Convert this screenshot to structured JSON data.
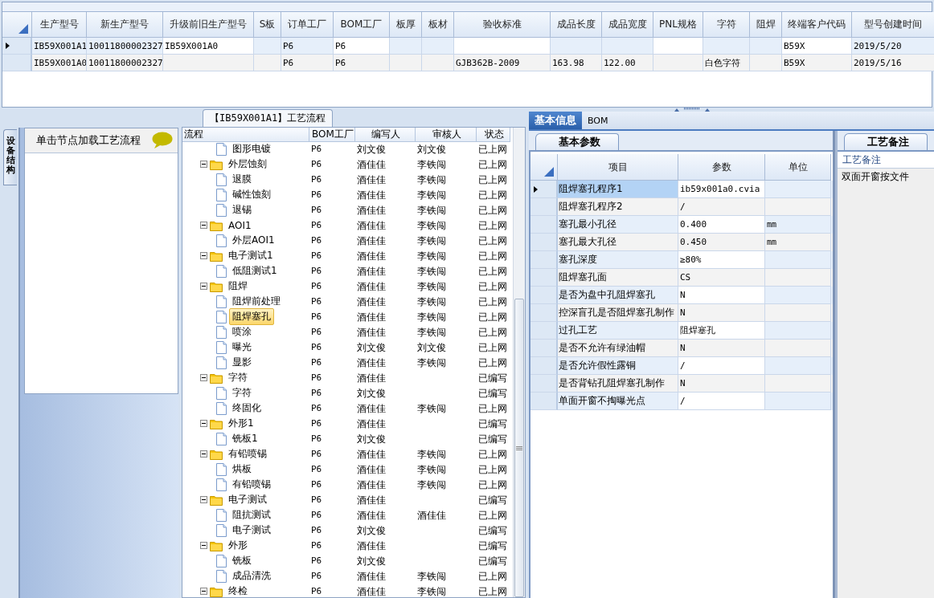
{
  "model_grid": {
    "columns": [
      "生产型号",
      "新生产型号",
      "升级前旧生产型号",
      "S板",
      "订单工厂",
      "BOM工厂",
      "板厚",
      "板材",
      "验收标准",
      "成品长度",
      "成品宽度",
      "PNL规格",
      "字符",
      "阻焊",
      "终端客户代码",
      "型号创建时间"
    ],
    "rows": [
      {
        "selected": true,
        "cells": [
          "IB59X001A1",
          "10011800002327",
          "IB59X001A0",
          "",
          "P6",
          "P6",
          "",
          "",
          "",
          "",
          "",
          "",
          "",
          "",
          "B59X",
          "2019/5/20"
        ]
      },
      {
        "selected": false,
        "cells": [
          "IB59X001A0",
          "10011800002327",
          "",
          "",
          "P6",
          "P6",
          "",
          "",
          "GJB362B-2009",
          "163.98",
          "122.00",
          "",
          "白色字符",
          "",
          "B59X",
          "2019/5/16"
        ]
      }
    ]
  },
  "left_panel": {
    "side_tab": "设备结构",
    "hint": "单击节点加载工艺流程"
  },
  "flow": {
    "title": "【IB59X001A1】工艺流程",
    "columns": [
      "流程",
      "BOM工厂",
      "编写人",
      "审核人",
      "状态"
    ],
    "partial_children": [
      {
        "name": "图形电镀",
        "bom": "P6",
        "author": "刘文俊",
        "reviewer": "刘文俊",
        "status": "已上网",
        "selected": false
      }
    ],
    "nodes": [
      {
        "name": "外层蚀刻",
        "bom": "P6",
        "author": "酒佳佳",
        "reviewer": "李铁闯",
        "status": "已上网",
        "selected": false,
        "expanded": true,
        "children": [
          {
            "name": "退膜",
            "bom": "P6",
            "author": "酒佳佳",
            "reviewer": "李铁闯",
            "status": "已上网",
            "selected": false
          },
          {
            "name": "碱性蚀刻",
            "bom": "P6",
            "author": "酒佳佳",
            "reviewer": "李铁闯",
            "status": "已上网",
            "selected": false
          },
          {
            "name": "退锡",
            "bom": "P6",
            "author": "酒佳佳",
            "reviewer": "李铁闯",
            "status": "已上网",
            "selected": false
          }
        ]
      },
      {
        "name": "AOI1",
        "bom": "P6",
        "author": "酒佳佳",
        "reviewer": "李铁闯",
        "status": "已上网",
        "selected": false,
        "expanded": true,
        "children": [
          {
            "name": "外层AOI1",
            "bom": "P6",
            "author": "酒佳佳",
            "reviewer": "李铁闯",
            "status": "已上网",
            "selected": false
          }
        ]
      },
      {
        "name": "电子测试1",
        "bom": "P6",
        "author": "酒佳佳",
        "reviewer": "李铁闯",
        "status": "已上网",
        "selected": false,
        "expanded": true,
        "children": [
          {
            "name": "低阻测试1",
            "bom": "P6",
            "author": "酒佳佳",
            "reviewer": "李铁闯",
            "status": "已上网",
            "selected": false
          }
        ]
      },
      {
        "name": "阻焊",
        "bom": "P6",
        "author": "酒佳佳",
        "reviewer": "李铁闯",
        "status": "已上网",
        "selected": false,
        "expanded": true,
        "children": [
          {
            "name": "阻焊前处理",
            "bom": "P6",
            "author": "酒佳佳",
            "reviewer": "李铁闯",
            "status": "已上网",
            "selected": false
          },
          {
            "name": "阻焊塞孔",
            "bom": "P6",
            "author": "酒佳佳",
            "reviewer": "李铁闯",
            "status": "已上网",
            "selected": true
          },
          {
            "name": "喷涂",
            "bom": "P6",
            "author": "酒佳佳",
            "reviewer": "李铁闯",
            "status": "已上网",
            "selected": false
          },
          {
            "name": "曝光",
            "bom": "P6",
            "author": "刘文俊",
            "reviewer": "刘文俊",
            "status": "已上网",
            "selected": false
          },
          {
            "name": "显影",
            "bom": "P6",
            "author": "酒佳佳",
            "reviewer": "李铁闯",
            "status": "已上网",
            "selected": false
          }
        ]
      },
      {
        "name": "字符",
        "bom": "P6",
        "author": "酒佳佳",
        "status": "已编写",
        "selected": false,
        "expanded": true,
        "children": [
          {
            "name": "字符",
            "bom": "P6",
            "author": "刘文俊",
            "status": "已编写",
            "selected": false
          },
          {
            "name": "终固化",
            "bom": "P6",
            "author": "酒佳佳",
            "reviewer": "李铁闯",
            "status": "已上网",
            "selected": false
          }
        ]
      },
      {
        "name": "外形1",
        "bom": "P6",
        "author": "酒佳佳",
        "status": "已编写",
        "selected": false,
        "expanded": true,
        "children": [
          {
            "name": "铣板1",
            "bom": "P6",
            "author": "刘文俊",
            "status": "已编写",
            "selected": false
          }
        ]
      },
      {
        "name": "有铅喷锡",
        "bom": "P6",
        "author": "酒佳佳",
        "reviewer": "李铁闯",
        "status": "已上网",
        "selected": false,
        "expanded": true,
        "children": [
          {
            "name": "烘板",
            "bom": "P6",
            "author": "酒佳佳",
            "reviewer": "李铁闯",
            "status": "已上网",
            "selected": false
          },
          {
            "name": "有铅喷锡",
            "bom": "P6",
            "author": "酒佳佳",
            "reviewer": "李铁闯",
            "status": "已上网",
            "selected": false
          }
        ]
      },
      {
        "name": "电子测试",
        "bom": "P6",
        "author": "酒佳佳",
        "status": "已编写",
        "selected": false,
        "expanded": true,
        "children": [
          {
            "name": "阻抗测试",
            "bom": "P6",
            "author": "酒佳佳",
            "reviewer": "酒佳佳",
            "status": "已上网",
            "selected": false
          },
          {
            "name": "电子测试",
            "bom": "P6",
            "author": "刘文俊",
            "status": "已编写",
            "selected": false
          }
        ]
      },
      {
        "name": "外形",
        "bom": "P6",
        "author": "酒佳佳",
        "status": "已编写",
        "selected": false,
        "expanded": true,
        "children": [
          {
            "name": "铣板",
            "bom": "P6",
            "author": "刘文俊",
            "status": "已编写",
            "selected": false
          },
          {
            "name": "成品清洗",
            "bom": "P6",
            "author": "酒佳佳",
            "reviewer": "李铁闯",
            "status": "已上网",
            "selected": false
          }
        ]
      },
      {
        "name": "终检",
        "bom": "P6",
        "author": "酒佳佳",
        "reviewer": "李铁闯",
        "status": "已上网",
        "selected": false,
        "expanded": true
      }
    ]
  },
  "detail_tabs": [
    {
      "label": "基本信息",
      "selected": true
    },
    {
      "label": "BOM",
      "selected": false
    }
  ],
  "params": {
    "tab": "基本参数",
    "columns": [
      "项目",
      "参数",
      "单位"
    ],
    "rows": [
      {
        "item": "阻焊塞孔程序1",
        "value": "ib59x001a0.cvia",
        "selected": true
      },
      {
        "item": "阻焊塞孔程序2",
        "value": "/",
        "selected": false
      },
      {
        "item": "塞孔最小孔径",
        "value": "0.400",
        "unit": "mm",
        "selected": false
      },
      {
        "item": "塞孔最大孔径",
        "value": "0.450",
        "unit": "mm",
        "selected": false
      },
      {
        "item": "塞孔深度",
        "value": "≥80%",
        "selected": false
      },
      {
        "item": "阻焊塞孔面",
        "value": "CS",
        "selected": false
      },
      {
        "item": "是否为盘中孔阻焊塞孔",
        "value": "N",
        "selected": false
      },
      {
        "item": "控深盲孔是否阻焊塞孔制作",
        "value": "N",
        "selected": false
      },
      {
        "item": "过孔工艺",
        "value": "阻焊塞孔",
        "selected": false
      },
      {
        "item": "是否不允许有绿油帽",
        "value": "N",
        "selected": false
      },
      {
        "item": "是否允许假性露铜",
        "value": "/",
        "selected": false
      },
      {
        "item": "是否背钻孔阻焊塞孔制作",
        "value": "N",
        "selected": false
      },
      {
        "item": "单面开窗不掏曝光点",
        "value": "/",
        "selected": false
      }
    ]
  },
  "notes": {
    "tab": "工艺备注",
    "label": "工艺备注",
    "text": "双面开窗按文件"
  }
}
